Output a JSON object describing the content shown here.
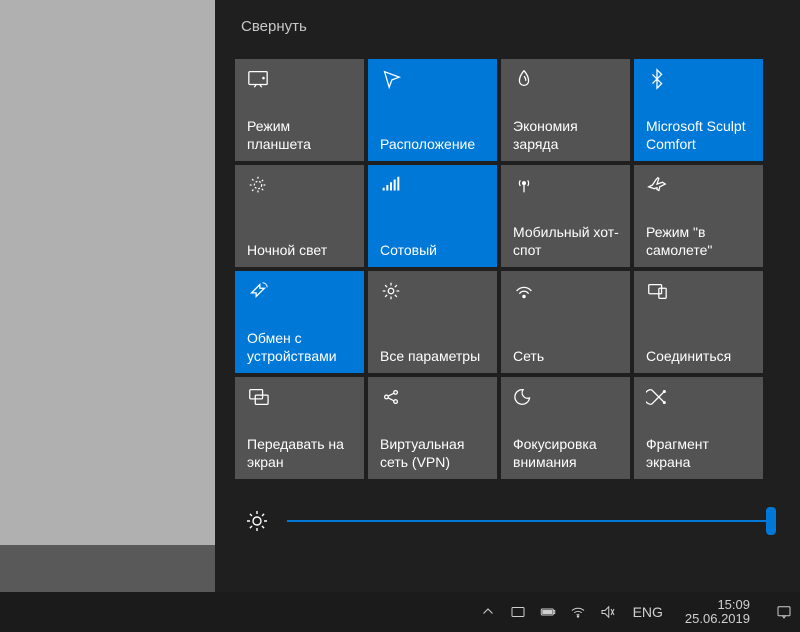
{
  "collapse_label": "Свернуть",
  "tiles": [
    {
      "label": "Режим планшета",
      "icon": "tablet-icon",
      "active": false
    },
    {
      "label": "Расположение",
      "icon": "location-icon",
      "active": true
    },
    {
      "label": "Экономия заряда",
      "icon": "battery-saver-icon",
      "active": false
    },
    {
      "label": "Microsoft Sculpt Comfort",
      "icon": "bluetooth-icon",
      "active": true
    },
    {
      "label": "Ночной свет",
      "icon": "night-light-icon",
      "active": false
    },
    {
      "label": "Сотовый",
      "icon": "cellular-icon",
      "active": true
    },
    {
      "label": "Мобильный хот-спот",
      "icon": "hotspot-icon",
      "active": false
    },
    {
      "label": "Режим \"в самолете\"",
      "icon": "airplane-icon",
      "active": false
    },
    {
      "label": "Обмен с устройствами",
      "icon": "nearby-share-icon",
      "active": true
    },
    {
      "label": "Все параметры",
      "icon": "settings-icon",
      "active": false
    },
    {
      "label": "Сеть",
      "icon": "network-icon",
      "active": false
    },
    {
      "label": "Соединиться",
      "icon": "connect-icon",
      "active": false
    },
    {
      "label": "Передавать на экран",
      "icon": "project-icon",
      "active": false
    },
    {
      "label": "Виртуальная сеть (VPN)",
      "icon": "vpn-icon",
      "active": false
    },
    {
      "label": "Фокусировка внимания",
      "icon": "focus-icon",
      "active": false
    },
    {
      "label": "Фрагмент экрана",
      "icon": "snip-icon",
      "active": false
    }
  ],
  "brightness_value": 100,
  "taskbar": {
    "language": "ENG",
    "time": "15:09",
    "date": "25.06.2019"
  },
  "colors": {
    "accent": "#0078d7",
    "tile_bg": "#535353",
    "panel_bg": "#1f1f1f"
  }
}
